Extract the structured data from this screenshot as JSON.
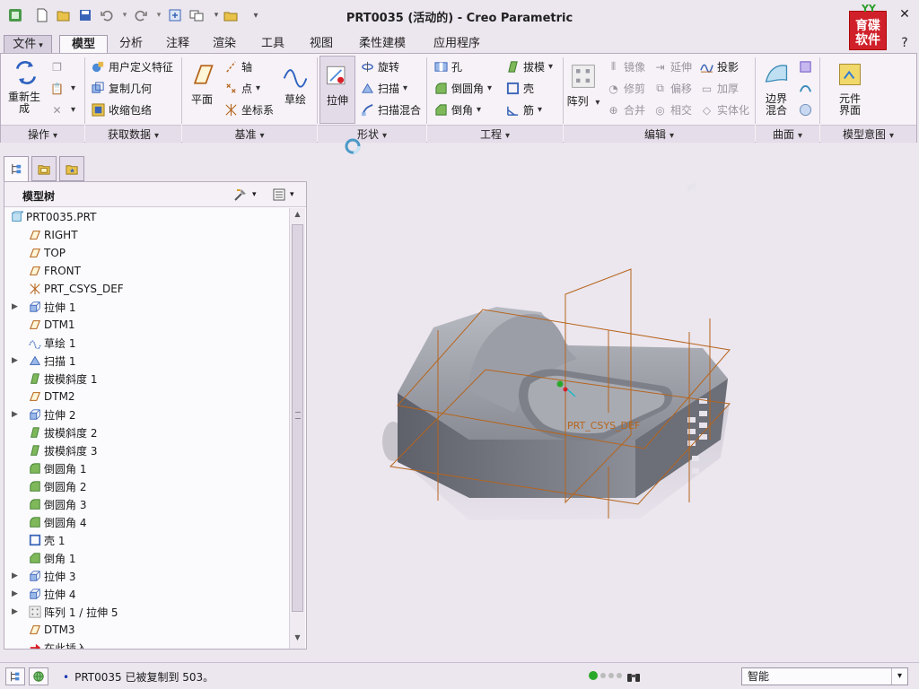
{
  "window": {
    "title": "PRT0035 (活动的) - Creo Parametric",
    "logo_text": "育碟软件",
    "logo_leaf": "YY"
  },
  "menu": {
    "tabs": [
      {
        "label": "文件",
        "kind": "file"
      },
      {
        "label": "模型",
        "kind": "active"
      },
      {
        "label": "分析"
      },
      {
        "label": "注释"
      },
      {
        "label": "渲染"
      },
      {
        "label": "工具"
      },
      {
        "label": "视图"
      },
      {
        "label": "柔性建模"
      },
      {
        "label": "应用程序"
      }
    ]
  },
  "ribbon": {
    "groups": {
      "operations": "操作",
      "get_data": "获取数据",
      "datum": "基准",
      "shapes": "形状",
      "engineering": "工程",
      "editing": "编辑",
      "surfaces": "曲面",
      "model_intent": "模型意图"
    },
    "regenerate": "重新生成",
    "user_defined_feature": "用户定义特征",
    "copy_geometry": "复制几何",
    "shrinkwrap": "收缩包络",
    "plane": "平面",
    "axis": "轴",
    "point": "点",
    "csys": "坐标系",
    "sketch": "草绘",
    "extrude": "拉伸",
    "revolve": "旋转",
    "sweep": "扫描",
    "swept_blend": "扫描混合",
    "hole": "孔",
    "round": "倒圆角",
    "chamfer": "倒角",
    "draft": "拔模",
    "shell": "壳",
    "rib": "筋",
    "pattern": "阵列",
    "mirror": "镜像",
    "trim": "修剪",
    "merge": "合并",
    "extend": "延伸",
    "offset": "偏移",
    "intersect": "相交",
    "project": "投影",
    "thicken": "加厚",
    "solidify": "实体化",
    "boundary_blend": "边界混合",
    "component_interface": "元件界面"
  },
  "model_tree": {
    "title": "模型树",
    "items": [
      {
        "label": "PRT0035.PRT",
        "icon": "part-icon",
        "expandable": false,
        "root": true
      },
      {
        "label": "RIGHT",
        "icon": "datum-plane-icon",
        "expandable": false
      },
      {
        "label": "TOP",
        "icon": "datum-plane-icon",
        "expandable": false
      },
      {
        "label": "FRONT",
        "icon": "datum-plane-icon",
        "expandable": false
      },
      {
        "label": "PRT_CSYS_DEF",
        "icon": "csys-icon",
        "expandable": false
      },
      {
        "label": "拉伸 1",
        "icon": "extrude-icon",
        "expandable": true
      },
      {
        "label": "DTM1",
        "icon": "datum-plane-icon",
        "expandable": false
      },
      {
        "label": "草绘 1",
        "icon": "sketch-icon",
        "expandable": false
      },
      {
        "label": "扫描 1",
        "icon": "sweep-icon",
        "expandable": true
      },
      {
        "label": "拔模斜度 1",
        "icon": "draft-icon",
        "expandable": false
      },
      {
        "label": "DTM2",
        "icon": "datum-plane-icon",
        "expandable": false
      },
      {
        "label": "拉伸 2",
        "icon": "extrude-icon",
        "expandable": true
      },
      {
        "label": "拔模斜度 2",
        "icon": "draft-icon",
        "expandable": false
      },
      {
        "label": "拔模斜度 3",
        "icon": "draft-icon",
        "expandable": false
      },
      {
        "label": "倒圆角 1",
        "icon": "round-icon",
        "expandable": false
      },
      {
        "label": "倒圆角 2",
        "icon": "round-icon",
        "expandable": false
      },
      {
        "label": "倒圆角 3",
        "icon": "round-icon",
        "expandable": false
      },
      {
        "label": "倒圆角 4",
        "icon": "round-icon",
        "expandable": false
      },
      {
        "label": "壳 1",
        "icon": "shell-icon",
        "expandable": false
      },
      {
        "label": "倒角 1",
        "icon": "chamfer-icon",
        "expandable": false
      },
      {
        "label": "拉伸 3",
        "icon": "extrude-icon",
        "expandable": true
      },
      {
        "label": "拉伸 4",
        "icon": "extrude-icon",
        "expandable": true
      },
      {
        "label": "阵列 1 / 拉伸 5",
        "icon": "pattern-icon",
        "expandable": true
      },
      {
        "label": "DTM3",
        "icon": "datum-plane-icon",
        "expandable": false
      },
      {
        "label": "在此插入",
        "icon": "insert-here-icon",
        "expandable": false
      }
    ]
  },
  "viewport": {
    "csys_label": "PRT_CSYS_DEF"
  },
  "status": {
    "message": "PRT0035 已被复制到 503。",
    "filter": "智能"
  },
  "colors": {
    "datum_orange": "#b5651d",
    "part_gray": "#8a8c95",
    "accent_blue": "#1a35b0"
  }
}
